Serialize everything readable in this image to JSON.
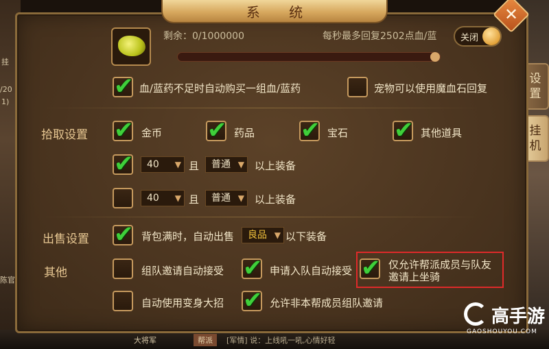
{
  "window": {
    "title": "系 统",
    "close_label": "✕"
  },
  "side_tabs": [
    {
      "label": "设置"
    },
    {
      "label": "挂机"
    }
  ],
  "top": {
    "remaining": "剩余：0/1000000",
    "regen_info": "每秒最多回复2502点血/蓝",
    "toggle_label": "关闭",
    "auto_buy_label": "血/蓝药不足时自动购买一组血/蓝药",
    "auto_buy_checked": true,
    "pet_label": "宠物可以使用魔血石回复",
    "pet_checked": false
  },
  "pickup": {
    "section": "拾取设置",
    "items": [
      {
        "label": "金币",
        "checked": true
      },
      {
        "label": "药品",
        "checked": true
      },
      {
        "label": "宝石",
        "checked": true
      },
      {
        "label": "其他道具",
        "checked": true
      }
    ],
    "rows": [
      {
        "checked": true,
        "level": "40",
        "and": "且",
        "quality": "普通",
        "suffix": "以上装备"
      },
      {
        "checked": false,
        "level": "40",
        "and": "且",
        "quality": "普通",
        "suffix": "以上装备"
      }
    ]
  },
  "sell": {
    "section": "出售设置",
    "checked": true,
    "label": "背包满时，自动出售",
    "quality": "良品",
    "suffix": "以下装备"
  },
  "other": {
    "section": "其他",
    "items": [
      {
        "label": "组队邀请自动接受",
        "checked": false
      },
      {
        "label": "申请入队自动接受",
        "checked": true
      },
      {
        "label": "仅允许帮派成员与队友",
        "label2": "邀请上坐骑",
        "checked": true
      },
      {
        "label": "自动使用变身大招",
        "checked": false
      },
      {
        "label": "允许非本帮成员组队邀请",
        "checked": true
      }
    ]
  },
  "scene": {
    "left_text_1": "挂",
    "left_text_2": "/20",
    "left_text_3": "1)",
    "left_text_4": "陈官",
    "bottom_name": "大将军",
    "bottom_tag": "帮派",
    "bottom_chat": "[军情]  说：上线吼一吼,心情好轻"
  },
  "watermark": {
    "brand": "高手游",
    "url": "GAOSHOUYOU.COM"
  },
  "colors": {
    "check": "#3fcf3a",
    "highlight": "#e02a2a",
    "gold_text": "#f2c33c"
  }
}
